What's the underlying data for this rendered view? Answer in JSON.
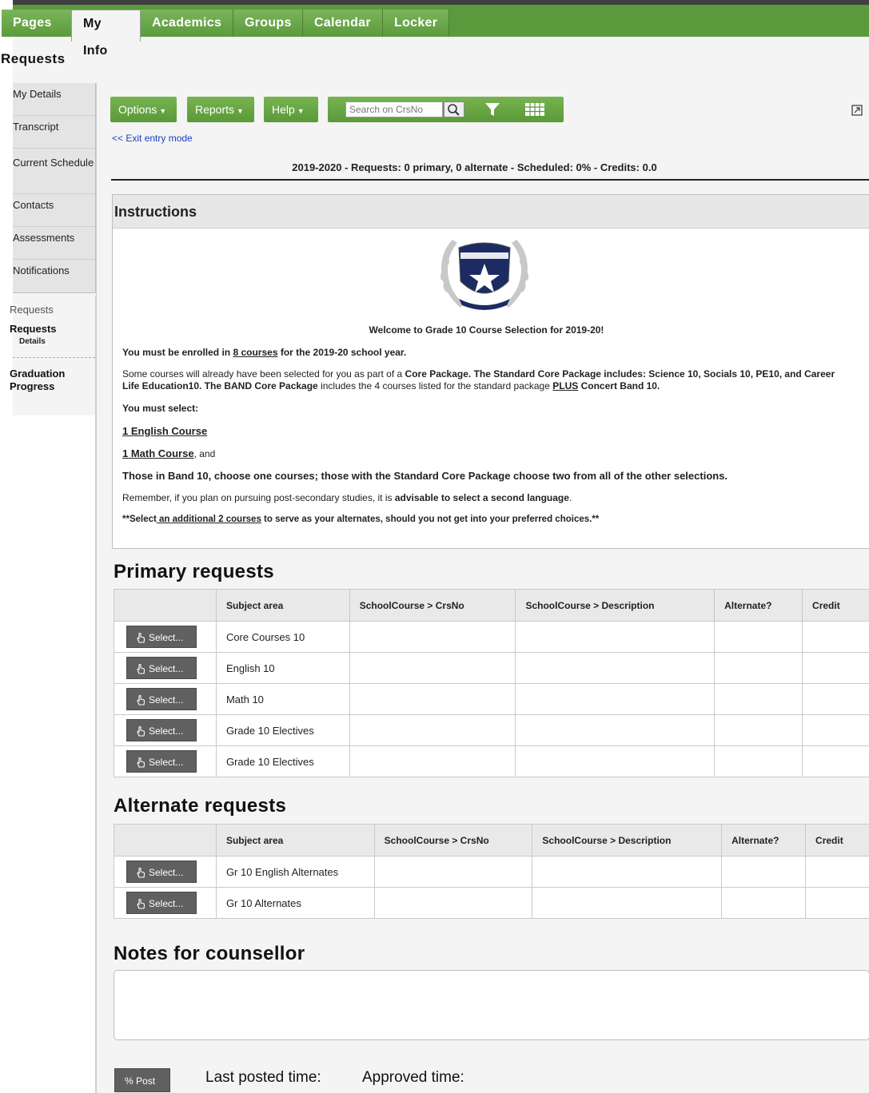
{
  "nav": {
    "tabs": [
      {
        "label": "Pages"
      },
      {
        "label": "My Info"
      },
      {
        "label": "Academics"
      },
      {
        "label": "Groups"
      },
      {
        "label": "Calendar"
      },
      {
        "label": "Locker"
      }
    ],
    "active_tab": "My Info"
  },
  "page_title": "Requests",
  "sidebar": {
    "items": [
      {
        "label": "My Details"
      },
      {
        "label": "Transcript"
      },
      {
        "label": "Current Schedule"
      },
      {
        "label": "Contacts"
      },
      {
        "label": "Assessments"
      },
      {
        "label": "Notifications"
      }
    ],
    "section_label": "Requests",
    "active_item": "Requests",
    "active_sub": "Details",
    "graduation": "Graduation Progress"
  },
  "toolbar": {
    "options_label": "Options",
    "reports_label": "Reports",
    "help_label": "Help",
    "search_placeholder": "Search on CrsNo"
  },
  "exit_link": "<< Exit entry mode",
  "summary": "2019-2020 - Requests: 0 primary, 0 alternate - Scheduled: 0% - Credits: 0.0",
  "instructions": {
    "heading": "Instructions",
    "welcome": "Welcome to Grade 10 Course Selection for 2019-20!",
    "enrolled_pre": "You must be enrolled in ",
    "enrolled_link": "8 courses",
    "enrolled_post": " for the 2019-20 school year.",
    "core_1": "Some courses will already have been selected for you as part of a ",
    "core_2": "Core Package. The Standard Core Package includes: Science 10, Socials 10, PE10, and Career Life Education10. The BAND Core Package",
    "core_3": " includes the 4 courses listed for the standard package ",
    "core_4": "PLUS",
    "core_5": " Concert Band 10.",
    "must_select": "You must select:",
    "english": "1 English Course",
    "math": "1 Math Course",
    "math_suffix": ", and",
    "band": "Those in Band 10, choose one courses; those with the Standard Core Package choose two from all of the other selections.",
    "remember_1": "Remember, if you plan on pursuing post-secondary studies, it is ",
    "remember_2": "advisable to select a second language",
    "remember_3": ".",
    "alt_1": "**Select",
    "alt_2": " an additional 2 courses",
    "alt_3": " to serve as your alternates, should you not get into your preferred choices.**"
  },
  "primary": {
    "title": "Primary requests",
    "columns": [
      "Subject area",
      "SchoolCourse > CrsNo",
      "SchoolCourse > Description",
      "Alternate?",
      "Credit"
    ],
    "rows": [
      {
        "select": "Select...",
        "subject": "Core Courses 10"
      },
      {
        "select": "Select...",
        "subject": "English 10"
      },
      {
        "select": "Select...",
        "subject": "Math 10"
      },
      {
        "select": "Select...",
        "subject": "Grade 10 Electives"
      },
      {
        "select": "Select...",
        "subject": "Grade 10 Electives"
      }
    ]
  },
  "alternate": {
    "title": "Alternate requests",
    "columns": [
      "Subject area",
      "SchoolCourse > CrsNo",
      "SchoolCourse > Description",
      "Alternate?",
      "Credit"
    ],
    "rows": [
      {
        "select": "Select...",
        "subject": "Gr 10 English Alternates"
      },
      {
        "select": "Select...",
        "subject": "Gr 10 Alternates"
      }
    ]
  },
  "notes": {
    "title": "Notes for counsellor",
    "value": ""
  },
  "footer": {
    "post_label": "Post",
    "last_posted": "Last posted time:",
    "approved": "Approved time:"
  },
  "colors": {
    "nav_green": "#5b9a3c",
    "link_blue": "#1a3fc4",
    "select_button": "#606060"
  }
}
